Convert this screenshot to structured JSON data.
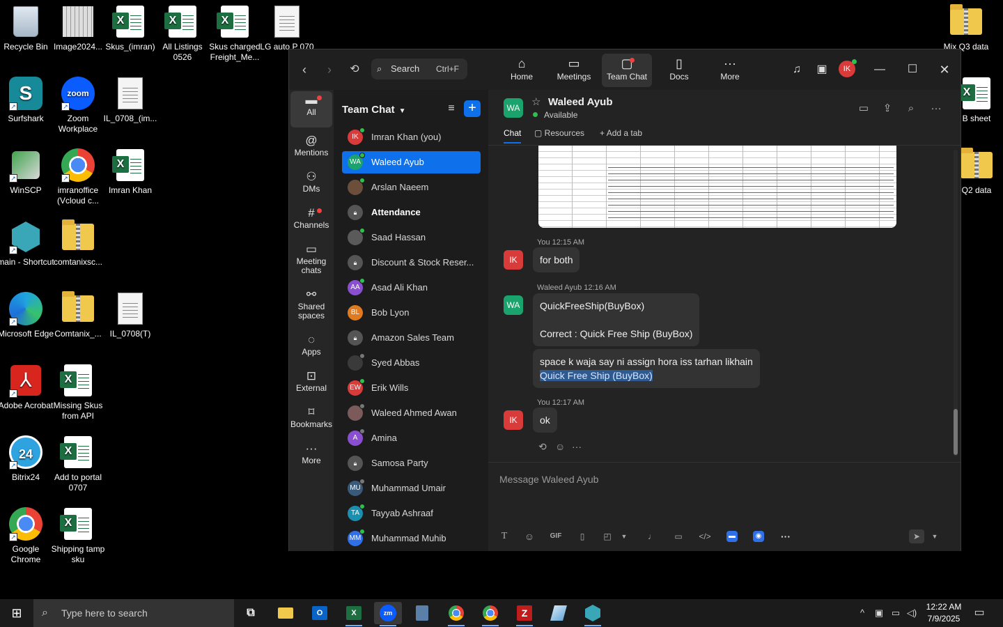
{
  "desktop": {
    "icons_left": [
      {
        "label": "Recycle Bin"
      },
      {
        "label": "Image2024..."
      },
      {
        "label": "Skus_(imran)"
      },
      {
        "label": "All Listings 0526"
      },
      {
        "label": "Skus charged Freight_Me..."
      },
      {
        "label": "LG auto P 070"
      },
      {
        "label": "Surfshark"
      },
      {
        "label": "Zoom Workplace"
      },
      {
        "label": "IL_0708_(im..."
      },
      {
        "label": "WinSCP"
      },
      {
        "label": "imranoffice (Vcloud c..."
      },
      {
        "label": "Imran Khan"
      },
      {
        "label": "main - Shortcut"
      },
      {
        "label": "comtanixsc..."
      },
      {
        "label": "Microsoft Edge"
      },
      {
        "label": "Comtanix_..."
      },
      {
        "label": "IL_0708(T)"
      },
      {
        "label": "Adobe Acrobat"
      },
      {
        "label": "Missing Skus from API"
      },
      {
        "label": "Bitrix24"
      },
      {
        "label": "Add to portal 0707"
      },
      {
        "label": "Google Chrome"
      },
      {
        "label": "Shipping tamp sku"
      }
    ],
    "icons_right": [
      {
        "label": "Mix Q3 data"
      },
      {
        "label": "B sheet"
      },
      {
        "label": "Q2 data"
      }
    ],
    "zoom_icon_text": "zoom",
    "bitrix_icon_text": "24"
  },
  "zoom": {
    "search": {
      "label": "Search",
      "shortcut": "Ctrl+F"
    },
    "nav_tabs": [
      {
        "label": "Home",
        "icon": "home-icon"
      },
      {
        "label": "Meetings",
        "icon": "video-icon"
      },
      {
        "label": "Team Chat",
        "icon": "chat-icon"
      },
      {
        "label": "Docs",
        "icon": "doc-icon"
      },
      {
        "label": "More",
        "icon": "more-icon"
      }
    ],
    "user_initials": "IK",
    "rail": [
      {
        "label": "All"
      },
      {
        "label": "Mentions"
      },
      {
        "label": "DMs"
      },
      {
        "label": "Channels"
      },
      {
        "label": "Meeting chats"
      },
      {
        "label": "Shared spaces"
      },
      {
        "label": "Apps"
      },
      {
        "label": "External"
      },
      {
        "label": "Bookmarks"
      },
      {
        "label": "More"
      }
    ],
    "list_title": "Team Chat",
    "contacts": [
      {
        "name": "Imran Khan (you)",
        "initials": "IK",
        "color": "#d93a3a"
      },
      {
        "name": "Waleed Ayub",
        "initials": "WA",
        "color": "#1aa36c"
      },
      {
        "name": "Arslan Naeem",
        "initials": "",
        "color": "#6b4f3a"
      },
      {
        "name": "Attendance",
        "initials": "",
        "color": "#555555"
      },
      {
        "name": "Saad Hassan",
        "initials": "",
        "color": "#5a5a5a"
      },
      {
        "name": "Discount & Stock Reser...",
        "initials": "",
        "color": "#555555"
      },
      {
        "name": "Asad Ali Khan",
        "initials": "AA",
        "color": "#8a4fd0"
      },
      {
        "name": "Bob Lyon",
        "initials": "BL",
        "color": "#e07a20"
      },
      {
        "name": "Amazon Sales Team",
        "initials": "",
        "color": "#555555"
      },
      {
        "name": "Syed Abbas",
        "initials": "",
        "color": "#3a3a3a"
      },
      {
        "name": "Erik Wills",
        "initials": "EW",
        "color": "#d93a3a"
      },
      {
        "name": "Waleed Ahmed Awan",
        "initials": "",
        "color": "#7a5a5a"
      },
      {
        "name": "Amina",
        "initials": "A",
        "color": "#8a4fd0"
      },
      {
        "name": "Samosa Party",
        "initials": "",
        "color": "#555555"
      },
      {
        "name": "Muhammad Umair",
        "initials": "MU",
        "color": "#3a5a7a"
      },
      {
        "name": "Tayyab Ashraaf",
        "initials": "TA",
        "color": "#1a8fb0"
      },
      {
        "name": "Muhammad Muhib",
        "initials": "MM",
        "color": "#2f6fe8"
      }
    ],
    "chat": {
      "header_initials": "WA",
      "header_name": "Waleed Ayub",
      "status": "Available",
      "tabs": {
        "chat": "Chat",
        "resources": "Resources",
        "add_tab": "Add a tab"
      },
      "messages": [
        {
          "meta": "You 12:15 AM",
          "initials": "IK",
          "text": "for both"
        },
        {
          "meta": "Waleed Ayub 12:16 AM",
          "initials": "WA",
          "text1": "QuickFreeShip(BuyBox)",
          "text2": "Correct : Quick Free Ship (BuyBox)"
        },
        {
          "text1": "space k waja say ni assign hora iss tarhan likhain",
          "text2": "Quick Free Ship (BuyBox)"
        },
        {
          "meta": "You 12:17 AM",
          "initials": "IK",
          "text": "ok"
        }
      ],
      "composer_placeholder": "Message Waleed Ayub",
      "gif_label": "GIF"
    }
  },
  "taskbar": {
    "search_placeholder": "Type here to search",
    "time": "12:22 AM",
    "date": "7/9/2025",
    "zoom_app_text": "zm"
  }
}
